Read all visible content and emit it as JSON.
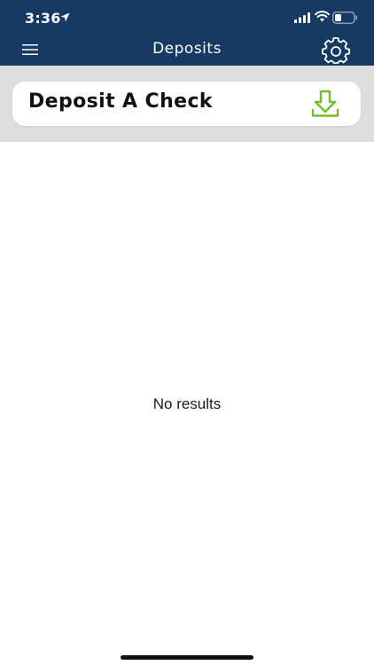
{
  "status_bar": {
    "time": "3:36"
  },
  "nav": {
    "title": "Deposits"
  },
  "deposit_action": {
    "label": "Deposit A Check",
    "accent_color": "#6fbe2e"
  },
  "list": {
    "empty_message": "No results"
  },
  "colors": {
    "header_bg": "#163a63",
    "banner_bg": "#dedede"
  }
}
